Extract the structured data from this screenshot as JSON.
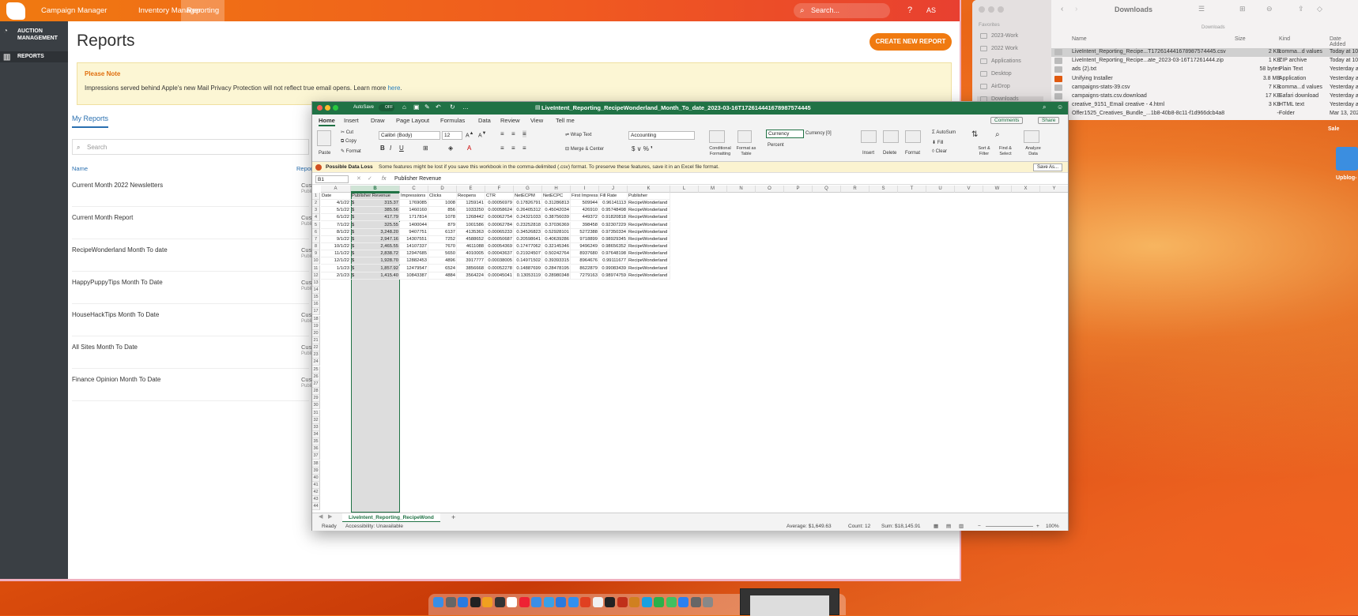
{
  "browser": {
    "nav": [
      "Campaign Manager",
      "Inventory Manager",
      "Reporting"
    ],
    "search_placeholder": "Search...",
    "help": "?",
    "user": "AS",
    "sidebar": [
      "AUCTION MANAGEMENT",
      "REPORTS"
    ],
    "title": "Reports",
    "create_button": "CREATE NEW REPORT",
    "note_title": "Please Note",
    "note_body": "Impressions served behind Apple's new Mail Privacy Protection will not reflect true email opens. Learn more ",
    "note_link": "here",
    "my_reports_tab": "My Reports",
    "report_search_placeholder": "Search",
    "col_name": "Name",
    "col_report": "Repor",
    "reports": [
      {
        "name": "Current Month 2022 Newsletters",
        "type": "Custo",
        "sub": "Publish"
      },
      {
        "name": "Current Month Report",
        "type": "Custo",
        "sub": "Publish"
      },
      {
        "name": "RecipeWonderland Month To date",
        "type": "Custo",
        "sub": "Publish"
      },
      {
        "name": "HappyPuppyTips Month To Date",
        "type": "Custo",
        "sub": "Publish"
      },
      {
        "name": "HouseHackTips Month To Date",
        "type": "Custo",
        "sub": "Publish"
      },
      {
        "name": "All Sites Month To Date",
        "type": "Custo",
        "sub": "Publish"
      },
      {
        "name": "Finance Opinion Month To Date",
        "type": "Custo",
        "sub": "Publish"
      }
    ]
  },
  "finder": {
    "title": "Downloads",
    "subtitle": "Downloads",
    "favorites_label": "Favorites",
    "sidebar": [
      "2023-Work",
      "2022 Work",
      "Applications",
      "Desktop",
      "AirDrop",
      "Downloads"
    ],
    "headers": [
      "Name",
      "Size",
      "Kind",
      "Date Added"
    ],
    "files": [
      {
        "name": "LiveIntent_Reporting_Recipe...T1726144416​78987574445.csv",
        "size": "2 KB",
        "kind": "comma...d values",
        "date": "Today at 10"
      },
      {
        "name": "LiveIntent_Reporting_Recipe...ate_2023-03-16T17261444.zip",
        "size": "1 KB",
        "kind": "ZIP archive",
        "date": "Today at 10"
      },
      {
        "name": "ads (2).txt",
        "size": "58 bytes",
        "kind": "Plain Text",
        "date": "Yesterday a"
      },
      {
        "name": "Unifying Installer",
        "size": "3.8 MB",
        "kind": "Application",
        "date": "Yesterday a"
      },
      {
        "name": "campaigns-stats-39.csv",
        "size": "7 KB",
        "kind": "comma...d values",
        "date": "Yesterday a"
      },
      {
        "name": "campaigns-stats.csv.download",
        "size": "17 KB",
        "kind": "Safari download",
        "date": "Yesterday a"
      },
      {
        "name": "creative_9151_Email creative - 4.html",
        "size": "3 KB",
        "kind": "HTML text",
        "date": "Yesterday a"
      },
      {
        "name": "Offer1525_Creatives_Bundle_...1b8-40b8-8c11-f1d966dcb4a8",
        "size": "--",
        "kind": "Folder",
        "date": "Mar 13, 202"
      }
    ]
  },
  "desktop": {
    "label1": "Upblog-",
    "label2": "Sale"
  },
  "excel": {
    "autosave": "AutoSave",
    "autosave_state": "OFF",
    "title": "LiveIntent_Reporting_RecipeWonderland_Month_To_date_2023-03-16T17261444167898757444​5",
    "tabs": [
      "Home",
      "Insert",
      "Draw",
      "Page Layout",
      "Formulas",
      "Data",
      "Review",
      "View",
      "Tell me"
    ],
    "comments": "Comments",
    "share": "Share",
    "ribbon": {
      "paste": "Paste",
      "cut": "Cut",
      "copy": "Copy",
      "format": "Format",
      "font": "Calibri (Body)",
      "size": "12",
      "wrap": "Wrap Text",
      "merge": "Merge & Center",
      "numfmt": "Accounting",
      "cond": "Conditional Formatting",
      "fat": "Format as Table",
      "style1": "Currency",
      "style2": "Currency [0]",
      "style3": "Percent",
      "insert": "Insert",
      "delete": "Delete",
      "format2": "Format",
      "autosum": "AutoSum",
      "fill": "Fill",
      "clear": "Clear",
      "sort": "Sort & Filter",
      "find": "Find & Select",
      "analyze": "Analyze Data"
    },
    "warn_title": "Possible Data Loss",
    "warn_text": "Some features might be lost if you save this workbook in the comma-delimited (.csv) format. To preserve these features, save it in an Excel file format.",
    "save_as": "Save As...",
    "cell_ref": "B1",
    "fx": "fx",
    "formula": "Publisher Revenue",
    "columns": [
      "A",
      "B",
      "C",
      "D",
      "E",
      "F",
      "G",
      "H",
      "I",
      "J",
      "K",
      "L",
      "M",
      "N",
      "O",
      "P",
      "Q",
      "R",
      "S",
      "T",
      "U",
      "V",
      "W",
      "X",
      "Y"
    ],
    "header_row": [
      "Date",
      "Publisher Revenue",
      "Impressions",
      "Clicks",
      "Reopens",
      "CTR",
      "NetECPM",
      "NetECPC",
      "First Impress",
      "Fill Rate",
      "Publisher"
    ],
    "rows": [
      [
        "4/1/22",
        "$",
        "315.37",
        "1769085",
        "1008",
        "1259141",
        "0.00056979",
        "0.17826791",
        "0.31286813",
        "509944",
        "0.96141113",
        "RecipeWonderland"
      ],
      [
        "5/1/22",
        "$",
        "385.56",
        "1460160",
        "856",
        "1033250",
        "0.00058624",
        "0.26405312",
        "0.45042034",
        "426910",
        "0.95748498",
        "RecipeWonderland"
      ],
      [
        "6/1/22",
        "$",
        "417.79",
        "1717814",
        "1078",
        "1268442",
        "0.00062754",
        "0.24321033",
        "0.38756039",
        "449372",
        "0.91820818",
        "RecipeWonderland"
      ],
      [
        "7/1/22",
        "$",
        "325.55",
        "1400044",
        "879",
        "1001586",
        "0.00062784",
        "0.23252818",
        "0.37036369",
        "398458",
        "0.92307229",
        "RecipeWonderland"
      ],
      [
        "8/1/22",
        "$",
        "3,248.20",
        "9407751",
        "6137",
        "4135363",
        "0.00065233",
        "0.34526823",
        "0.52928101",
        "5272388",
        "0.97350334",
        "RecipeWonderland"
      ],
      [
        "9/1/22",
        "$",
        "2,947.16",
        "14307551",
        "7252",
        "4588652",
        "0.00050687",
        "0.20598641",
        "0.40639286",
        "9718899",
        "0.98929345",
        "RecipeWonderland"
      ],
      [
        "10/1/22",
        "$",
        "2,465.55",
        "14107337",
        "7670",
        "4611088",
        "0.00054369",
        "0.17477062",
        "0.32145346",
        "9496249",
        "0.98656352",
        "RecipeWonderland"
      ],
      [
        "11/1/22",
        "$",
        "2,838.72",
        "12947685",
        "5650",
        "4010005",
        "0.00043637",
        "0.21924507",
        "0.50242764",
        "8937680",
        "0.97648198",
        "RecipeWonderland"
      ],
      [
        "12/1/22",
        "$",
        "1,928.70",
        "12882453",
        "4896",
        "3917777",
        "0.00038005",
        "0.14971502",
        "0.39393315",
        "8964676",
        "0.99111677",
        "RecipeWonderland"
      ],
      [
        "1/1/23",
        "$",
        "1,857.92",
        "12479547",
        "6524",
        "3856668",
        "0.00052278",
        "0.14887699",
        "0.28478195",
        "8622879",
        "0.99083439",
        "RecipeWonderland"
      ],
      [
        "2/1/23",
        "$",
        "1,415.40",
        "10843387",
        "4884",
        "3564224",
        "0.00045041",
        "0.13053119",
        "0.28980348",
        "7279163",
        "0.98974759",
        "RecipeWonderland"
      ]
    ],
    "sheet_tab": "LiveIntent_Reporting_RecipeWond",
    "status": {
      "ready": "Ready",
      "access": "Accessibility: Unavailable",
      "avg": "Average: $1,649.63",
      "count": "Count: 12",
      "sum": "Sum: $18,145.91",
      "zoom": "100%"
    }
  }
}
